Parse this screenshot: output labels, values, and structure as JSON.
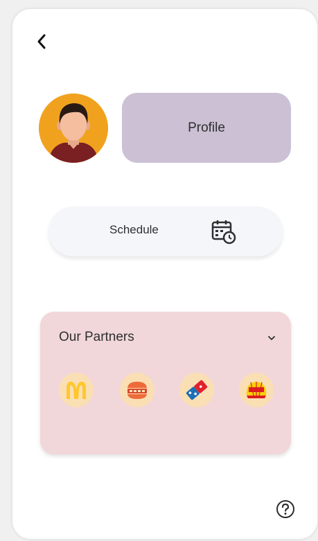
{
  "header": {
    "back_icon": "chevron-left-icon"
  },
  "profile": {
    "avatar_icon": "user-avatar",
    "button_label": "Profile",
    "button_color": "#cbc0d4"
  },
  "schedule": {
    "button_label": "Schedule",
    "icon": "calendar-clock-icon"
  },
  "partners": {
    "title": "Our Partners",
    "toggle_icon": "chevron-down-icon",
    "card_color": "#f1d7da",
    "items": [
      {
        "name": "mcdonalds-logo"
      },
      {
        "name": "burger-logo"
      },
      {
        "name": "dominos-logo"
      },
      {
        "name": "shell-logo"
      }
    ]
  },
  "help": {
    "icon": "help-icon"
  }
}
